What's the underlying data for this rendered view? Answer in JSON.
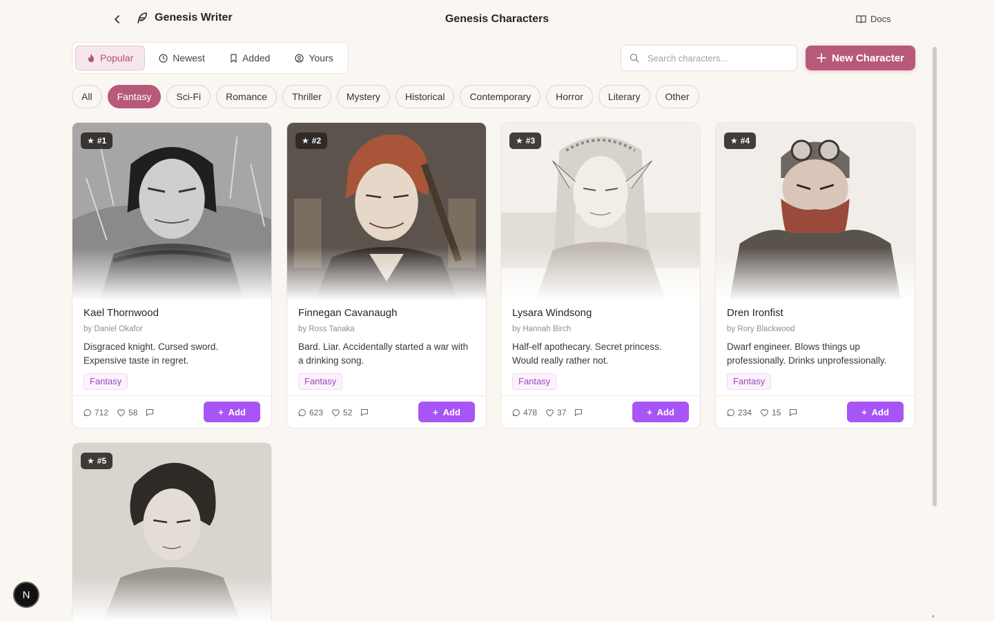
{
  "header": {
    "back_icon": "chevron-left-icon",
    "brand_icon": "feather-icon",
    "brand_name": "Genesis Writer",
    "page_title": "Genesis Characters",
    "docs_icon": "book-open-icon",
    "docs_label": "Docs"
  },
  "sort_tabs": [
    {
      "label": "Popular",
      "icon": "flame-icon",
      "active": true
    },
    {
      "label": "Newest",
      "icon": "clock-icon",
      "active": false
    },
    {
      "label": "Added",
      "icon": "bookmark-icon",
      "active": false
    },
    {
      "label": "Yours",
      "icon": "user-circle-icon",
      "active": false
    }
  ],
  "search": {
    "placeholder": "Search characters...",
    "value": ""
  },
  "new_character_label": "New Character",
  "genres": [
    {
      "label": "All",
      "active": false
    },
    {
      "label": "Fantasy",
      "active": true
    },
    {
      "label": "Sci-Fi",
      "active": false
    },
    {
      "label": "Romance",
      "active": false
    },
    {
      "label": "Thriller",
      "active": false
    },
    {
      "label": "Mystery",
      "active": false
    },
    {
      "label": "Historical",
      "active": false
    },
    {
      "label": "Contemporary",
      "active": false
    },
    {
      "label": "Horror",
      "active": false
    },
    {
      "label": "Literary",
      "active": false
    },
    {
      "label": "Other",
      "active": false
    }
  ],
  "cards": [
    {
      "rank": "#1",
      "name": "Kael Thornwood",
      "author": "by Daniel Okafor",
      "desc": "Disgraced knight. Cursed sword. Expensive taste in regret.",
      "genre": "Fantasy",
      "comments": "712",
      "likes": "58",
      "add_label": "Add",
      "portrait": "dark-haired-knight"
    },
    {
      "rank": "#2",
      "name": "Finnegan Cavanaugh",
      "author": "by Ross Tanaka",
      "desc": "Bard. Liar. Accidentally started a war with a drinking song.",
      "genre": "Fantasy",
      "comments": "623",
      "likes": "52",
      "add_label": "Add",
      "portrait": "red-haired-bard"
    },
    {
      "rank": "#3",
      "name": "Lysara Windsong",
      "author": "by Hannah Birch",
      "desc": "Half-elf apothecary. Secret princess. Would really rather not.",
      "genre": "Fantasy",
      "comments": "478",
      "likes": "37",
      "add_label": "Add",
      "portrait": "elf-woman"
    },
    {
      "rank": "#4",
      "name": "Dren Ironfist",
      "author": "by Rory Blackwood",
      "desc": "Dwarf engineer. Blows things up professionally. Drinks unprofessionally.",
      "genre": "Fantasy",
      "comments": "234",
      "likes": "15",
      "add_label": "Add",
      "portrait": "bearded-dwarf"
    },
    {
      "rank": "#5",
      "name": "",
      "author": "",
      "desc": "",
      "genre": "",
      "comments": "",
      "likes": "",
      "add_label": "",
      "portrait": "short-haired-youth"
    }
  ],
  "colors": {
    "accent": "#b75a7a",
    "add_button": "#a855f7",
    "genre_tag_text": "#9b49b3",
    "background": "#faf6f1"
  },
  "fab_label": "N"
}
